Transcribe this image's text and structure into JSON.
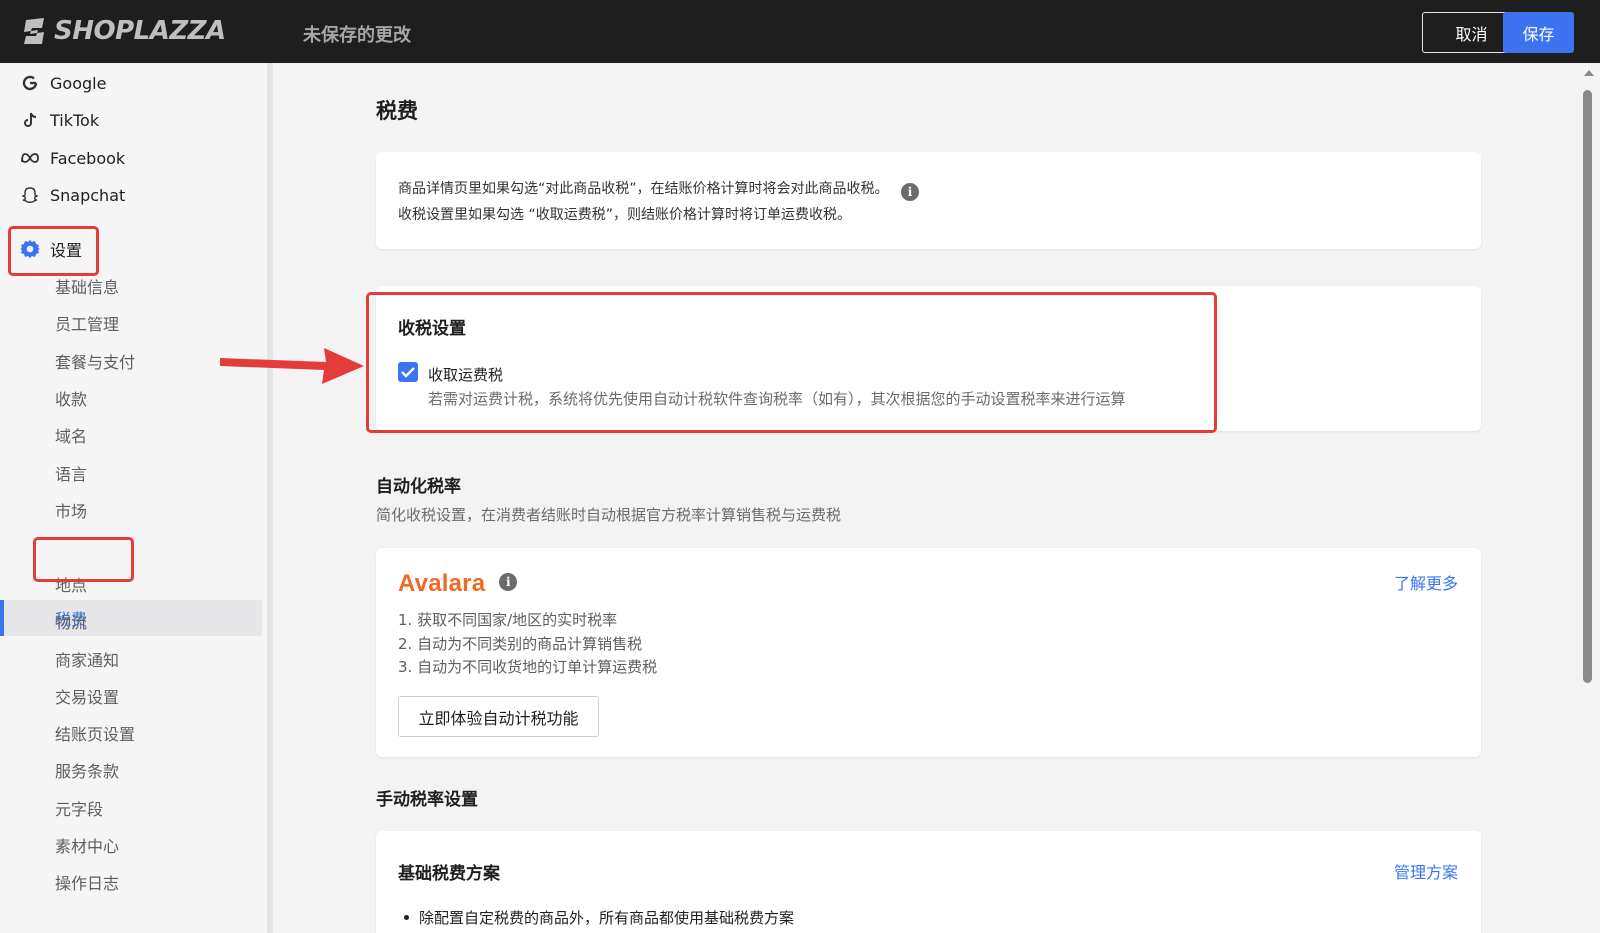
{
  "topbar": {
    "brand": "SHOPLAZZA",
    "unsaved_label": "未保存的更改",
    "cancel_label": "取消",
    "save_label": "保存"
  },
  "sidebar": {
    "channels": [
      {
        "label": "Google",
        "icon": "google-icon"
      },
      {
        "label": "TikTok",
        "icon": "tiktok-icon"
      },
      {
        "label": "Facebook",
        "icon": "meta-icon"
      },
      {
        "label": "Snapchat",
        "icon": "snapchat-icon"
      }
    ],
    "settings_label": "设置",
    "settings_items": [
      "基础信息",
      "员工管理",
      "套餐与支付",
      "收款",
      "域名",
      "语言",
      "市场",
      "税费",
      "地点",
      "物流",
      "商家通知",
      "交易设置",
      "结账页设置",
      "服务条款",
      "元字段",
      "素材中心",
      "操作日志"
    ],
    "active_item": "税费"
  },
  "main": {
    "title": "税费",
    "info": {
      "line1": "商品详情页里如果勾选“对此商品收税”，在结账价格计算时将会对此商品收税。",
      "line2": "收税设置里如果勾选 “收取运费税”，则结账价格计算时将订单运费收税。"
    },
    "tax_settings": {
      "title": "收税设置",
      "checkbox_label": "收取运费税",
      "checkbox_checked": true,
      "checkbox_help": "若需对运费计税，系统将优先使用自动计税软件查询税率（如有），其次根据您的手动设置税率来进行运算"
    },
    "auto_tax": {
      "title": "自动化税率",
      "desc": "简化收税设置，在消费者结账时自动根据官方税率计算销售税与运费税",
      "provider": "Avalara",
      "learn_more": "了解更多",
      "features": [
        "1. 获取不同国家/地区的实时税率",
        "2. 自动为不同类别的商品计算销售税",
        "3. 自动为不同收货地的订单计算运费税"
      ],
      "try_button": "立即体验自动计税功能"
    },
    "manual_tax": {
      "title": "手动税率设置",
      "plan_title": "基础税费方案",
      "manage_link": "管理方案",
      "bullet": "除配置自定税费的商品外，所有商品都使用基础税费方案"
    }
  },
  "colors": {
    "accent": "#3b73f2",
    "highlight": "#e43b3b",
    "topbar": "#1e1e1e"
  }
}
